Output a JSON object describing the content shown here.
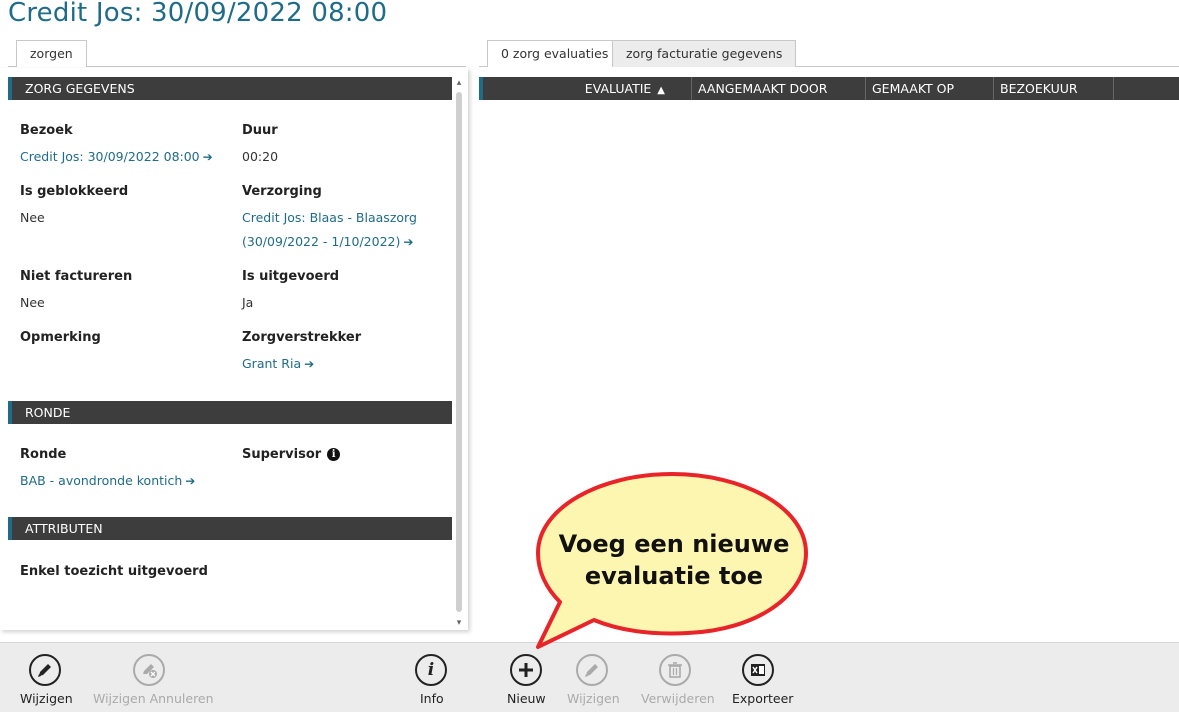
{
  "page": {
    "title": "Credit Jos: 30/09/2022 08:00"
  },
  "left_tabs": [
    {
      "label": "zorgen"
    }
  ],
  "right_tabs": [
    {
      "label": "0 zorg evaluaties"
    },
    {
      "label": "zorg facturatie gegevens"
    }
  ],
  "sections": {
    "zorg": {
      "header": "ZORG GEGEVENS"
    },
    "ronde": {
      "header": "RONDE"
    },
    "attributen": {
      "header": "ATTRIBUTEN"
    }
  },
  "fields": {
    "bezoek": {
      "label": "Bezoek",
      "value": "Credit Jos: 30/09/2022 08:00"
    },
    "duur": {
      "label": "Duur",
      "value": "00:20"
    },
    "geblokkeerd": {
      "label": "Is geblokkeerd",
      "value": "Nee"
    },
    "verzorging": {
      "label": "Verzorging",
      "value_line1": "Credit Jos: Blaas - Blaaszorg",
      "value_line2": "(30/09/2022 - 1/10/2022)"
    },
    "niet_factureren": {
      "label": "Niet factureren",
      "value": "Nee"
    },
    "uitgevoerd": {
      "label": "Is uitgevoerd",
      "value": "Ja"
    },
    "opmerking": {
      "label": "Opmerking"
    },
    "zorgverstrekker": {
      "label": "Zorgverstrekker",
      "value": "Grant Ria"
    },
    "ronde": {
      "label": "Ronde",
      "value": "BAB - avondronde kontich"
    },
    "supervisor": {
      "label": "Supervisor"
    },
    "enkel_toezicht": {
      "label": "Enkel toezicht uitgevoerd"
    }
  },
  "grid": {
    "columns": [
      "EVALUATIE",
      "AANGEMAAKT DOOR",
      "GEMAAKT OP",
      "BEZOEKUUR"
    ],
    "sort_indicator": "▲"
  },
  "toolbar": {
    "left": [
      {
        "label": "Wijzigen",
        "icon": "pencil-icon",
        "enabled": true
      },
      {
        "label": "Wijzigen Annuleren",
        "icon": "cancel-edit-icon",
        "enabled": false
      }
    ],
    "info": {
      "label": "Info",
      "icon": "info-icon"
    },
    "right": [
      {
        "label": "Nieuw",
        "icon": "plus-icon",
        "enabled": true
      },
      {
        "label": "Wijzigen",
        "icon": "pencil-icon",
        "enabled": false
      },
      {
        "label": "Verwijderen",
        "icon": "trash-icon",
        "enabled": false
      },
      {
        "label": "Exporteer",
        "icon": "excel-icon",
        "enabled": true
      }
    ]
  },
  "callout": {
    "line1": "Voeg een nieuwe",
    "line2": "evaluatie toe"
  },
  "colors": {
    "accent": "#1f6b8a",
    "header_bg": "#3d3d3d",
    "callout_fill": "#fdf6b0",
    "callout_border": "#e8232a"
  }
}
